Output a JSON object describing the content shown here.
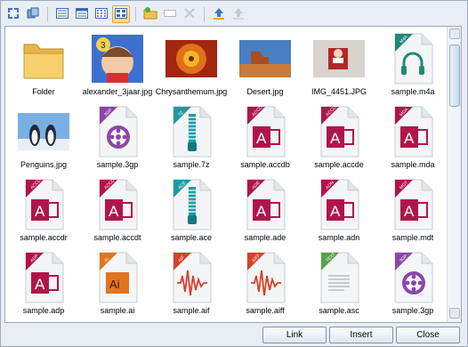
{
  "toolbar": {
    "buttons": [
      {
        "icon": "expand-view-icon"
      },
      {
        "icon": "refresh-icon"
      },
      {
        "icon": "list-view-icon"
      },
      {
        "icon": "details-view-icon"
      },
      {
        "icon": "small-icons-view-icon"
      },
      {
        "icon": "thumbnails-view-icon",
        "active": true
      },
      {
        "icon": "new-folder-icon"
      },
      {
        "icon": "rename-icon"
      },
      {
        "icon": "delete-icon"
      },
      {
        "icon": "upload-icon"
      },
      {
        "icon": "upload-disabled-icon"
      }
    ]
  },
  "files": [
    {
      "label": "Folder",
      "kind": "folder"
    },
    {
      "label": "alexander_3jaar.jpg",
      "kind": "photo-child"
    },
    {
      "label": "Chrysanthemum.jpg",
      "kind": "photo-flower"
    },
    {
      "label": "Desert.jpg",
      "kind": "photo-desert"
    },
    {
      "label": "IMG_4451.JPG",
      "kind": "photo-santa"
    },
    {
      "label": "sample.m4a",
      "kind": "audio",
      "badge": "M4A"
    },
    {
      "label": "Penguins.jpg",
      "kind": "photo-penguins"
    },
    {
      "label": "sample.3gp",
      "kind": "video",
      "badge": "3GP"
    },
    {
      "label": "sample.7z",
      "kind": "zip",
      "badge": "7Z"
    },
    {
      "label": "sample.accdb",
      "kind": "access",
      "badge": "ACCDB"
    },
    {
      "label": "sample.accde",
      "kind": "access",
      "badge": "ACCDE"
    },
    {
      "label": "sample.mda",
      "kind": "access",
      "badge": "MDA"
    },
    {
      "label": "sample.accdr",
      "kind": "access",
      "badge": "ACCDR"
    },
    {
      "label": "sample.accdt",
      "kind": "access",
      "badge": "ACCDT"
    },
    {
      "label": "sample.ace",
      "kind": "zip",
      "badge": "ACE"
    },
    {
      "label": "sample.ade",
      "kind": "access",
      "badge": "ADE"
    },
    {
      "label": "sample.adn",
      "kind": "access",
      "badge": "ADN"
    },
    {
      "label": "sample.mdt",
      "kind": "access",
      "badge": "MDT"
    },
    {
      "label": "sample.adp",
      "kind": "access",
      "badge": "ADP"
    },
    {
      "label": "sample.ai",
      "kind": "illustrator",
      "badge": "AI"
    },
    {
      "label": "sample.aif",
      "kind": "wave",
      "badge": "AIF"
    },
    {
      "label": "sample.aiff",
      "kind": "wave",
      "badge": "AIFF"
    },
    {
      "label": "sample.asc",
      "kind": "text",
      "badge": "TEXT"
    },
    {
      "label": "sample.3gp",
      "kind": "video",
      "badge": "3GP"
    }
  ],
  "buttons": {
    "link": "Link",
    "insert": "Insert",
    "close": "Close"
  },
  "colors": {
    "access": "#b0154a",
    "zip": "#1e9aa4",
    "video": "#8a47a9",
    "audio": "#1d8a7a",
    "illustrator": "#e2741f",
    "wave": "#d8412a",
    "text": "#58a34a"
  }
}
